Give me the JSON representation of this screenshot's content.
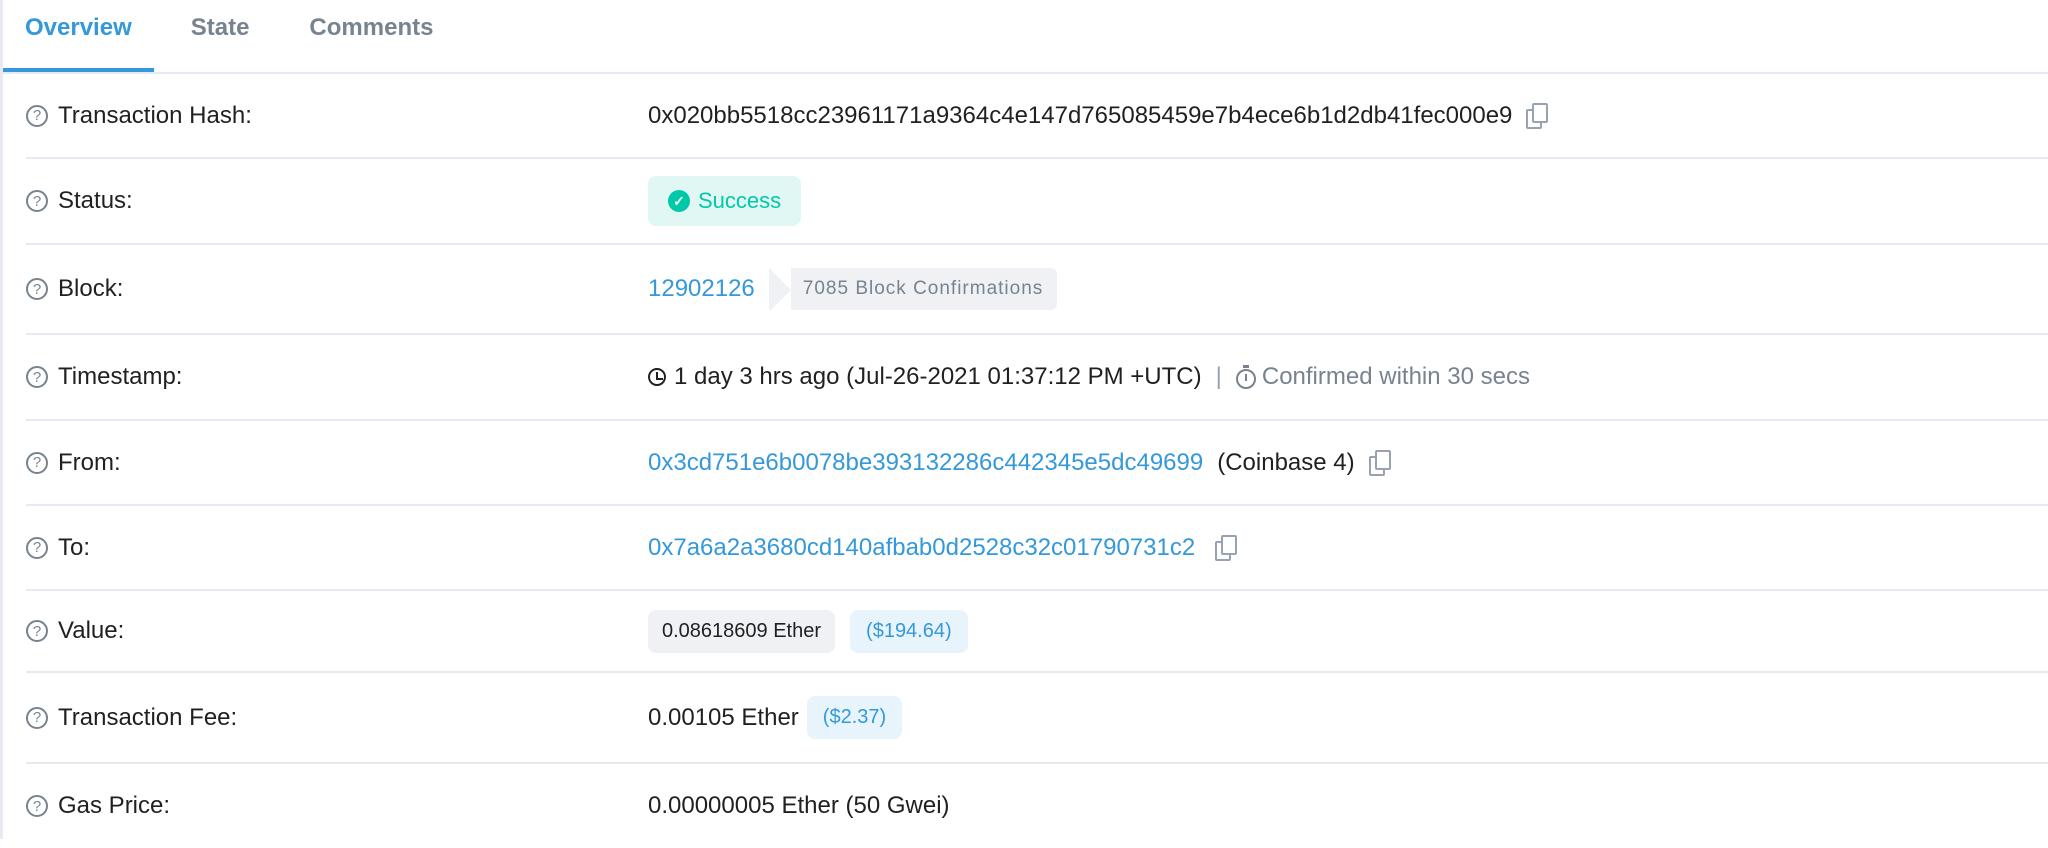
{
  "tabs": [
    {
      "label": "Overview",
      "active": true
    },
    {
      "label": "State",
      "active": false
    },
    {
      "label": "Comments",
      "active": false
    }
  ],
  "rows": {
    "tx_hash": {
      "label": "Transaction Hash:",
      "value": "0x020bb5518cc23961171a9364c4e147d765085459e7b4ece6b1d2db41fec000e9"
    },
    "status": {
      "label": "Status:",
      "value": "Success"
    },
    "block": {
      "label": "Block:",
      "number": "12902126",
      "confirmations": "7085 Block Confirmations"
    },
    "timestamp": {
      "label": "Timestamp:",
      "value": "1 day 3 hrs ago (Jul-26-2021 01:37:12 PM +UTC)",
      "separator": "|",
      "confirmed": "Confirmed within 30 secs"
    },
    "from": {
      "label": "From:",
      "address": "0x3cd751e6b0078be393132286c442345e5dc49699",
      "name_tag": "(Coinbase 4)"
    },
    "to": {
      "label": "To:",
      "address": "0x7a6a2a3680cd140afbab0d2528c32c01790731c2"
    },
    "value": {
      "label": "Value:",
      "ether": "0.08618609 Ether",
      "usd": "($194.64)"
    },
    "fee": {
      "label": "Transaction Fee:",
      "ether": "0.00105 Ether",
      "usd": "($2.37)"
    },
    "gas_price": {
      "label": "Gas Price:",
      "value": "0.00000005 Ether (50 Gwei)"
    }
  },
  "icons": {
    "help": "?",
    "check": "✓"
  },
  "colors": {
    "accent": "#3498db",
    "success": "#00c9a7",
    "muted": "#77838f",
    "text": "#1e2022"
  }
}
